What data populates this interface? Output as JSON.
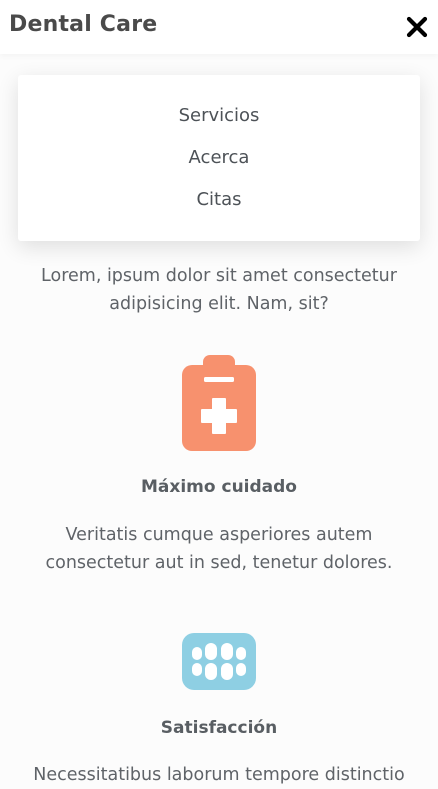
{
  "header": {
    "brand": "Dental Care",
    "close_icon": "close-icon"
  },
  "menu": {
    "items": [
      {
        "label": "Servicios"
      },
      {
        "label": "Acerca"
      },
      {
        "label": "Citas"
      }
    ]
  },
  "intro": {
    "text": "Lorem, ipsum dolor sit amet consectetur adipisicing elit. Nam, sit?"
  },
  "features": [
    {
      "icon": "clipboard-medical-icon",
      "title": "Máximo cuidado",
      "text": "Veritatis cumque asperiores autem consectetur aut in sed, tenetur dolores.",
      "color": "#f7916e"
    },
    {
      "icon": "teeth-icon",
      "title": "Satisfacción",
      "text": "Necessitatibus laborum tempore distinctio",
      "color": "#8ecfe3"
    }
  ],
  "colors": {
    "background": "#fcfcfc",
    "header_bg": "#ffffff",
    "text": "#5f6368",
    "brand_text": "#4a4a4a",
    "accent_orange": "#f7916e",
    "accent_blue": "#8ecfe3"
  }
}
